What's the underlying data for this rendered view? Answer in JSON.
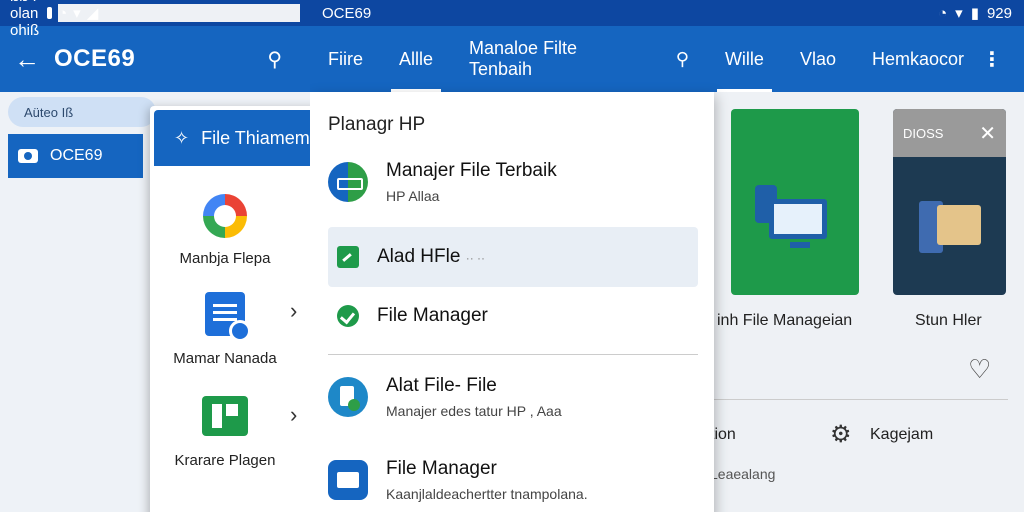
{
  "left": {
    "status_time": "ßß I olan ohiß",
    "app_title": "OCE69",
    "chip": "Aüteo Iß",
    "drive_label": "OCE69",
    "sheet_title": "File Thiamem",
    "apps": [
      {
        "label": "Manbja Flepa"
      },
      {
        "label": "Mamar Nanada"
      },
      {
        "label": "Krarare Plagen"
      }
    ]
  },
  "right": {
    "status_title": "OCE69",
    "status_time": "929",
    "tabs": [
      "Fiire",
      "Allle",
      "Manaloe Filte Tenbaih",
      "Wille",
      "Vlao",
      "Hemkaocor"
    ],
    "menu_title": "Planagr HP",
    "menu_items": [
      {
        "primary": "Manajer File Terbaik",
        "secondary": "HP Allaa"
      },
      {
        "primary": "Alad HFle",
        "secondary": "·· ··"
      },
      {
        "primary": "File Manager",
        "secondary": ""
      },
      {
        "primary": "Alat File- File",
        "secondary": "Manajer edes tatur HP , Aaa"
      },
      {
        "primary": "File Manager",
        "secondary": "Kaanjlaldeachertter tnampolana."
      }
    ],
    "card1_caption": "inh File Manageian",
    "card2_label": "DIOSS",
    "card2_caption": "Stun Hler",
    "row_left": "tion",
    "row_right": "Kagejam",
    "row_sub": "Leaealang"
  }
}
